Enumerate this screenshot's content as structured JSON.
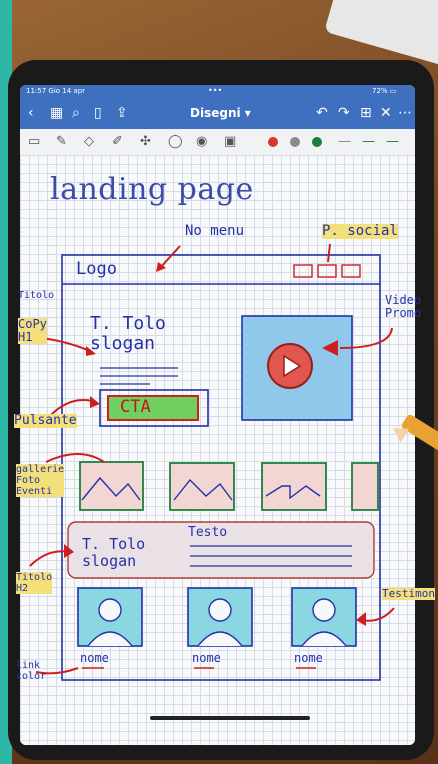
{
  "status": {
    "time": "11:57  Gio 14 apr",
    "dots": "•••",
    "battery": "72% ▭"
  },
  "doc": {
    "title": "Disegni ▾"
  },
  "colors": {
    "toolbar": "#3f6fbf",
    "ink_blue": "#2431a8",
    "ink_red": "#cc2020",
    "highlight_green": "#5fcf4a"
  },
  "toolbar_icons": [
    "back-icon",
    "grid-icon",
    "search-icon",
    "bookmark-icon",
    "share-icon",
    "undo-icon",
    "redo-icon",
    "add-page-icon",
    "close-icon",
    "more-icon"
  ],
  "sketch": {
    "heading": "landing page",
    "notes": {
      "no_menu": "No menu",
      "p_social": "P. social",
      "logo": "Logo",
      "titolo_top": "Titolo",
      "copy_h1": "CoPy\nH1",
      "titolo_slogan": "T. Tolo\nslogan",
      "video_promo": "Video\nPromo",
      "cta": "CTA",
      "pulsante": "Pulsante",
      "gallerie": "gallerie\nFoto\nEventi",
      "titolo_slogan_2": "T. Tolo\nslogan",
      "testo": "Testo",
      "titolo_h2": "Titolo\nH2",
      "testimon": "Testimon",
      "nome1": "nome",
      "nome2": "nome",
      "nome3": "nome",
      "link_color": "link\ncolor"
    }
  }
}
